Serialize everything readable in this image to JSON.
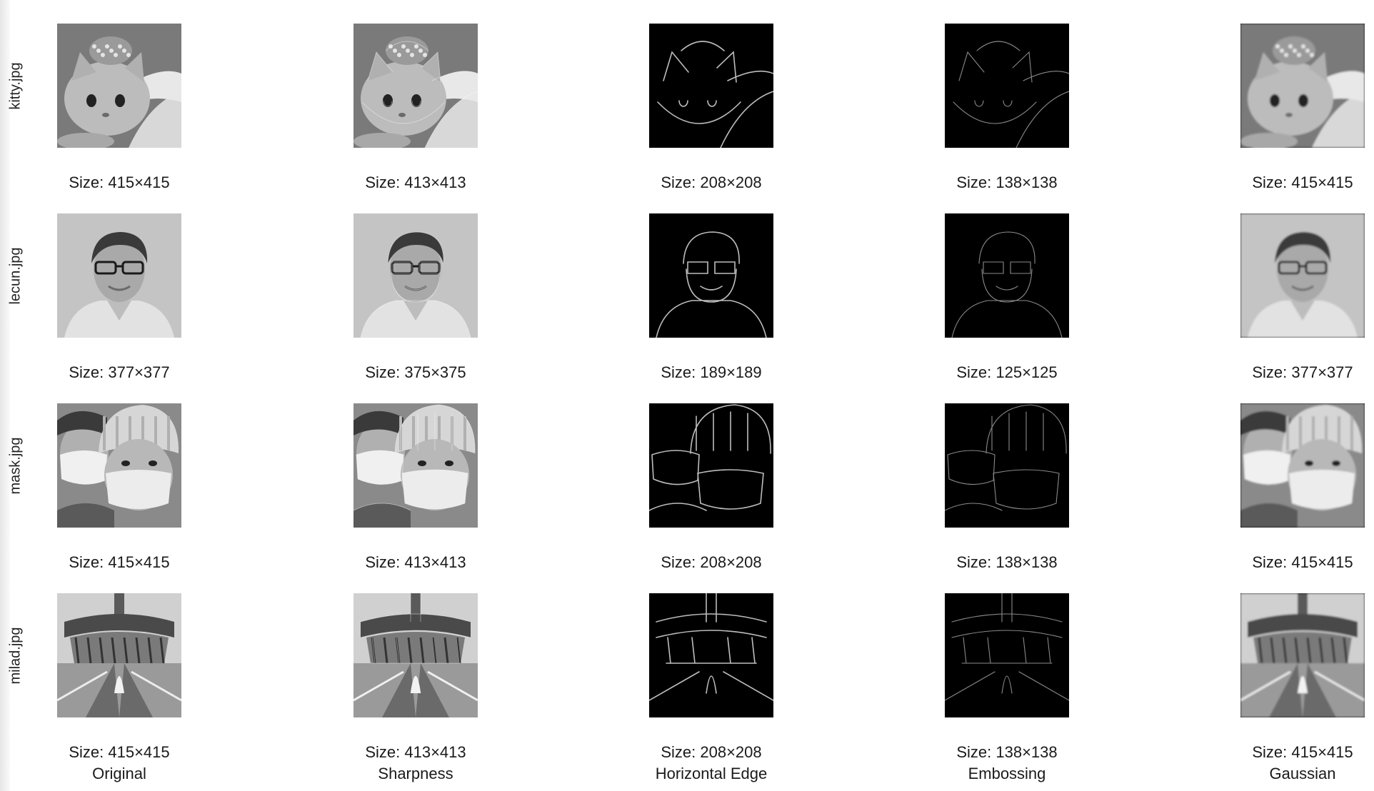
{
  "columns": [
    "Original",
    "Sharpness",
    "Horizontal Edge",
    "Embossing",
    "Gaussian"
  ],
  "rows": [
    {
      "label": "kitty.jpg",
      "subject": "kitten-with-tiara",
      "sizes": [
        "Size: 415×415",
        "Size: 413×413",
        "Size: 208×208",
        "Size: 138×138",
        "Size: 415×415"
      ]
    },
    {
      "label": "lecun.jpg",
      "subject": "man-portrait-glasses",
      "sizes": [
        "Size: 377×377",
        "Size: 375×375",
        "Size: 189×189",
        "Size: 125×125",
        "Size: 377×377"
      ]
    },
    {
      "label": "mask.jpg",
      "subject": "people-face-masks",
      "sizes": [
        "Size: 415×415",
        "Size: 413×413",
        "Size: 208×208",
        "Size: 138×138",
        "Size: 415×415"
      ]
    },
    {
      "label": "milad.jpg",
      "subject": "tower-fountain-architecture",
      "sizes": [
        "Size: 415×415",
        "Size: 413×413",
        "Size: 208×208",
        "Size: 138×138",
        "Size: 415×415"
      ]
    }
  ],
  "colors": {
    "background": "#ffffff",
    "text": "#1a1a1a",
    "edge_background": "#000000",
    "edge_line": "#bdbdbd",
    "emboss_line": "#8a8a8a"
  }
}
